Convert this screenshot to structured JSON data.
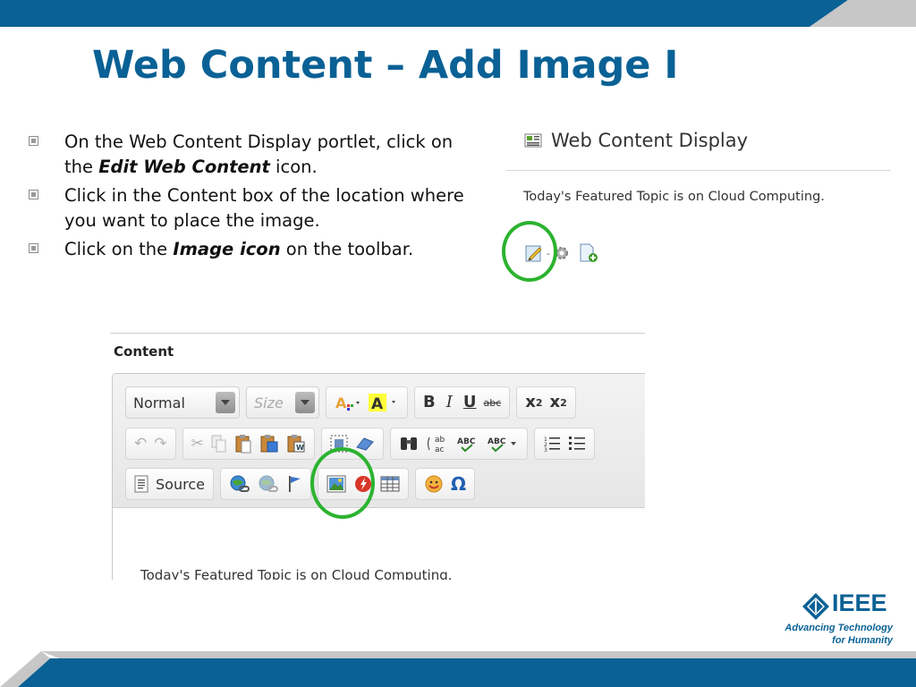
{
  "slide": {
    "title": "Web Content – Add Image I",
    "bullets": [
      {
        "pre": "On the Web Content Display portlet, click on the ",
        "em": "Edit Web Content",
        "post": " icon."
      },
      {
        "pre": "Click in the Content box of the location where you want to place the image.",
        "em": "",
        "post": ""
      },
      {
        "pre": "Click on the ",
        "em": "Image icon",
        "post": " on the toolbar."
      }
    ]
  },
  "portlet": {
    "title": "Web Content Display",
    "body_text": "Today's Featured Topic is on Cloud Computing.",
    "action_icons": [
      "edit-icon",
      "config-gear-icon",
      "add-content-icon"
    ]
  },
  "editor": {
    "label": "Content",
    "format_combo": "Normal",
    "size_combo": "Size",
    "bold_label": "B",
    "italic_label": "I",
    "underline_label": "U",
    "strike_label": "abc",
    "subscript_label": "x",
    "subscript_sub": "2",
    "superscript_label": "x",
    "superscript_sup": "2",
    "source_label": "Source",
    "omega_label": "Ω",
    "content_text": "Today's Featured Topic is on Cloud Computing."
  },
  "logo": {
    "name": "IEEE",
    "tagline_line1": "Advancing Technology",
    "tagline_line2": "for Humanity"
  },
  "colors": {
    "brand_blue": "#0a6195",
    "highlight_green": "#2bb32f",
    "bar_gray": "#bfbfbf"
  }
}
